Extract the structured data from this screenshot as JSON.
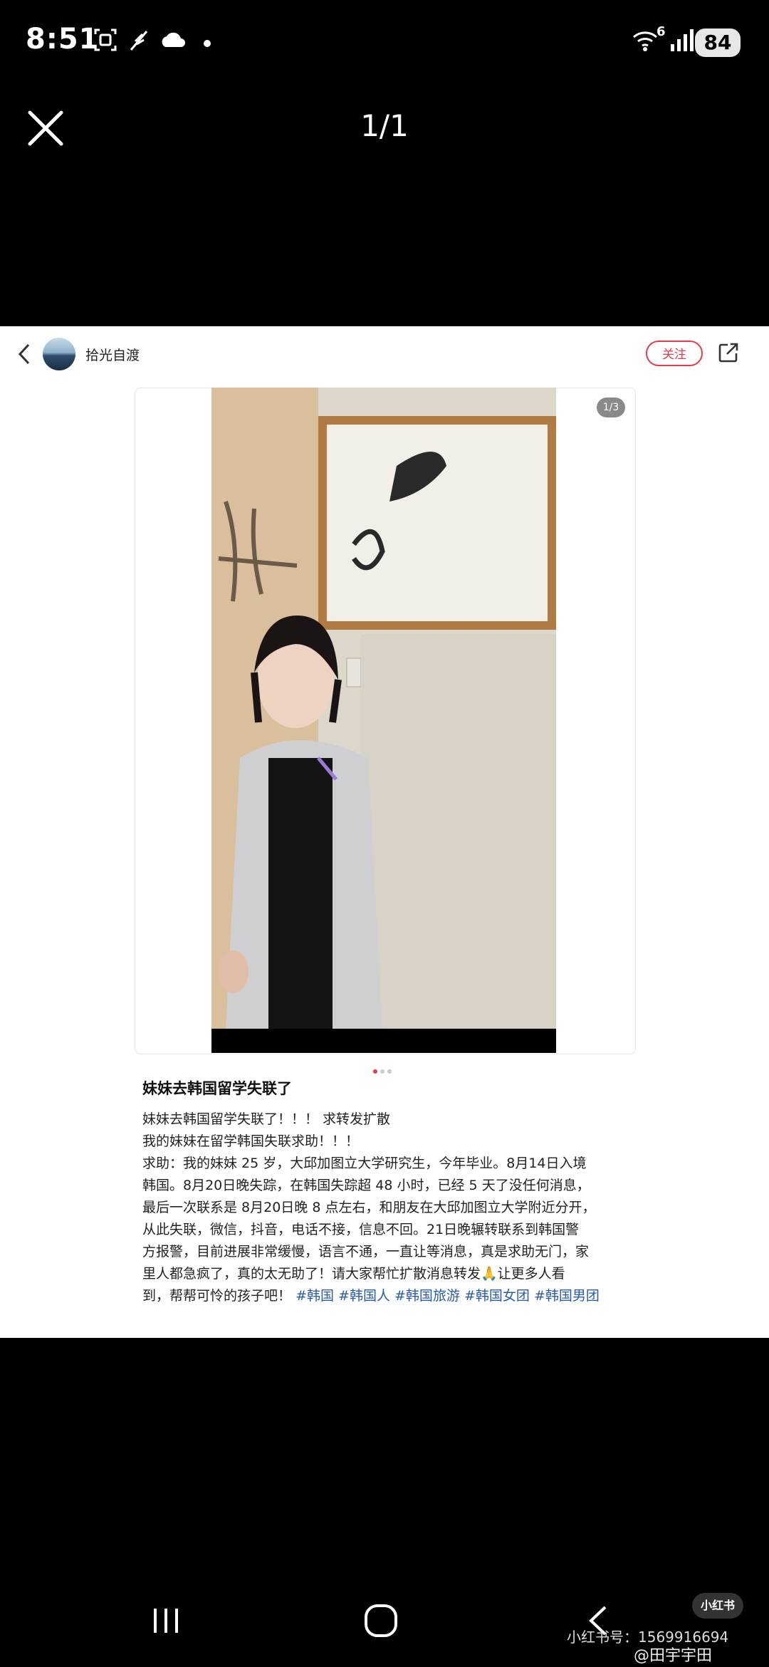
{
  "status_bar": {
    "time": "8:51",
    "battery": "84",
    "network_badge": "6"
  },
  "viewer": {
    "counter": "1/1"
  },
  "post": {
    "username": "拾光自渡",
    "follow_label": "关注",
    "image_counter": "1/3",
    "title": "妹妹去韩国留学失联了",
    "lines": [
      "妹妹去韩国留学失联了！！！ 求转发扩散",
      "我的妹妹在留学韩国失联求助！！！",
      "求助：我的妹妹 25 岁，大邱加图立大学研究生，今年毕业。8月14日入境",
      "韩国。8月20日晚失踪，在韩国失踪超 48 小时，已经 5 天了没任何消息，",
      "最后一次联系是 8月20日晚 8 点左右，和朋友在大邱加图立大学附近分开，",
      "从此失联，微信，抖音，电话不接，信息不回。21日晚辗转联系到韩国警",
      "方报警，目前进展非常缓慢，语言不通，一直让等消息，真是求助无门，家",
      "里人都急疯了，真的太无助了！请大家帮忙扩散消息转发🙏让更多人看"
    ],
    "last_line_text": "到，帮帮可怜的孩子吧！",
    "tags": [
      "#韩国",
      "#韩国人",
      "#韩国旅游",
      "#韩国女团",
      "#韩国男团"
    ]
  },
  "watermark": {
    "logo": "小红书",
    "id": "小红书号：1569916694",
    "weibo": "@田宇宇田"
  },
  "icons": {
    "close": "close-icon",
    "back": "chevron-left-icon",
    "share": "share-icon",
    "recents": "recents-icon",
    "home": "home-icon",
    "nav_back": "nav-back-icon"
  }
}
